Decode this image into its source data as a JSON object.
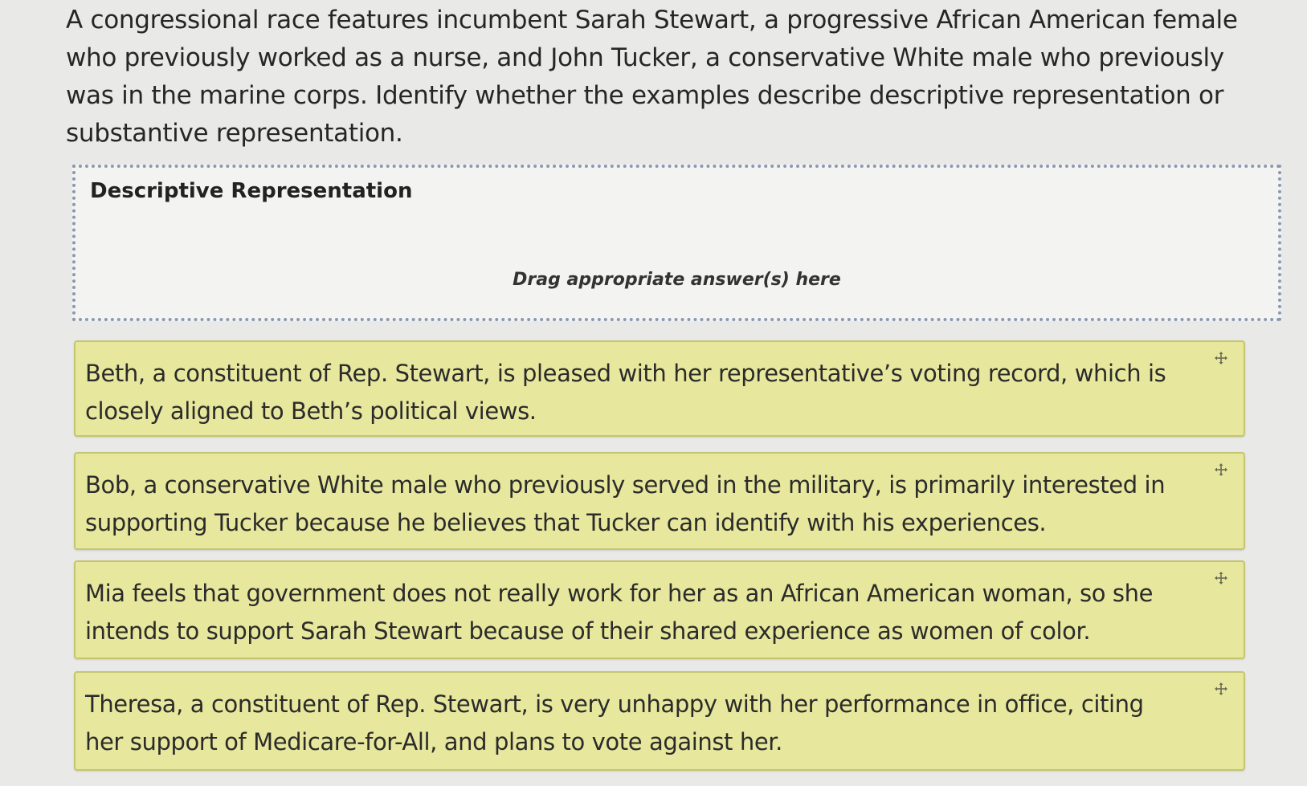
{
  "question": {
    "text": "A congressional race features incumbent Sarah Stewart, a progressive African American female who previously worked as a nurse, and John Tucker, a conservative White male who previously was in the marine corps. Identify whether the examples describe descriptive representation or substantive representation."
  },
  "dropzone": {
    "title": "Descriptive Representation",
    "hint": "Drag appropriate answer(s) here"
  },
  "answers": [
    {
      "text": "Beth, a constituent of Rep. Stewart, is pleased with her representative’s voting record, which is closely aligned to Beth’s political views.",
      "handle_icon": "move-icon"
    },
    {
      "text": "Bob, a conservative White male who previously served in the military, is primarily interested in supporting Tucker because he believes that Tucker can identify with his experiences.",
      "handle_icon": "move-icon"
    },
    {
      "text": "Mia feels that government does not really work for her as an African American woman, so she intends to support Sarah Stewart because of their shared experience as women of color.",
      "handle_icon": "move-icon"
    },
    {
      "text": "Theresa, a constituent of Rep. Stewart, is very unhappy with her performance in office, citing her support of Medicare-for-All, and plans to vote against her.",
      "handle_icon": "move-icon"
    }
  ],
  "colors": {
    "card_background": "#e7e89d",
    "card_border": "#c4c66f",
    "dropzone_border": "#8a99b0",
    "page_background": "#e9e9e8"
  }
}
